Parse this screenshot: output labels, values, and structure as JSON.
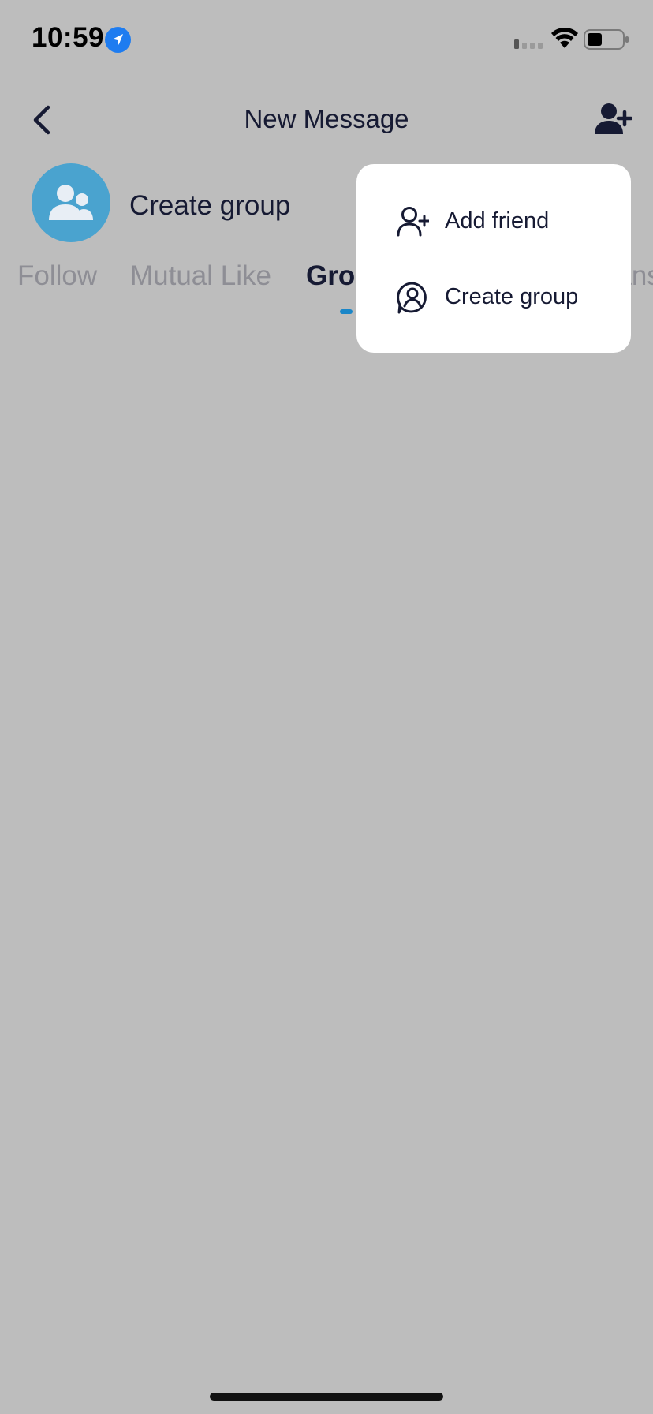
{
  "status_bar": {
    "time": "10:59",
    "location_icon": "location-arrow-icon",
    "signal_icon": "cellular-signal-icon",
    "wifi_icon": "wifi-icon",
    "battery_icon": "battery-icon"
  },
  "header": {
    "title": "New Message",
    "back_icon": "chevron-left-icon",
    "add_icon": "person-plus-icon"
  },
  "create_group": {
    "label": "Create group",
    "icon": "group-people-icon",
    "avatar_color": "#4aa3cf"
  },
  "tabs": {
    "items": [
      {
        "label": "Follow"
      },
      {
        "label": "Mutual Like"
      },
      {
        "label": "Group",
        "active": true
      },
      {
        "label": "Fans"
      }
    ],
    "indicator_color": "#1a86c8"
  },
  "popup_menu": {
    "items": [
      {
        "label": "Add friend",
        "icon": "person-plus-icon"
      },
      {
        "label": "Create group",
        "icon": "group-chat-icon"
      }
    ]
  },
  "colors": {
    "background_overlay": "#bdbdbd",
    "text_primary": "#161a33",
    "text_secondary": "#8e8e95",
    "popup_background": "#ffffff"
  }
}
